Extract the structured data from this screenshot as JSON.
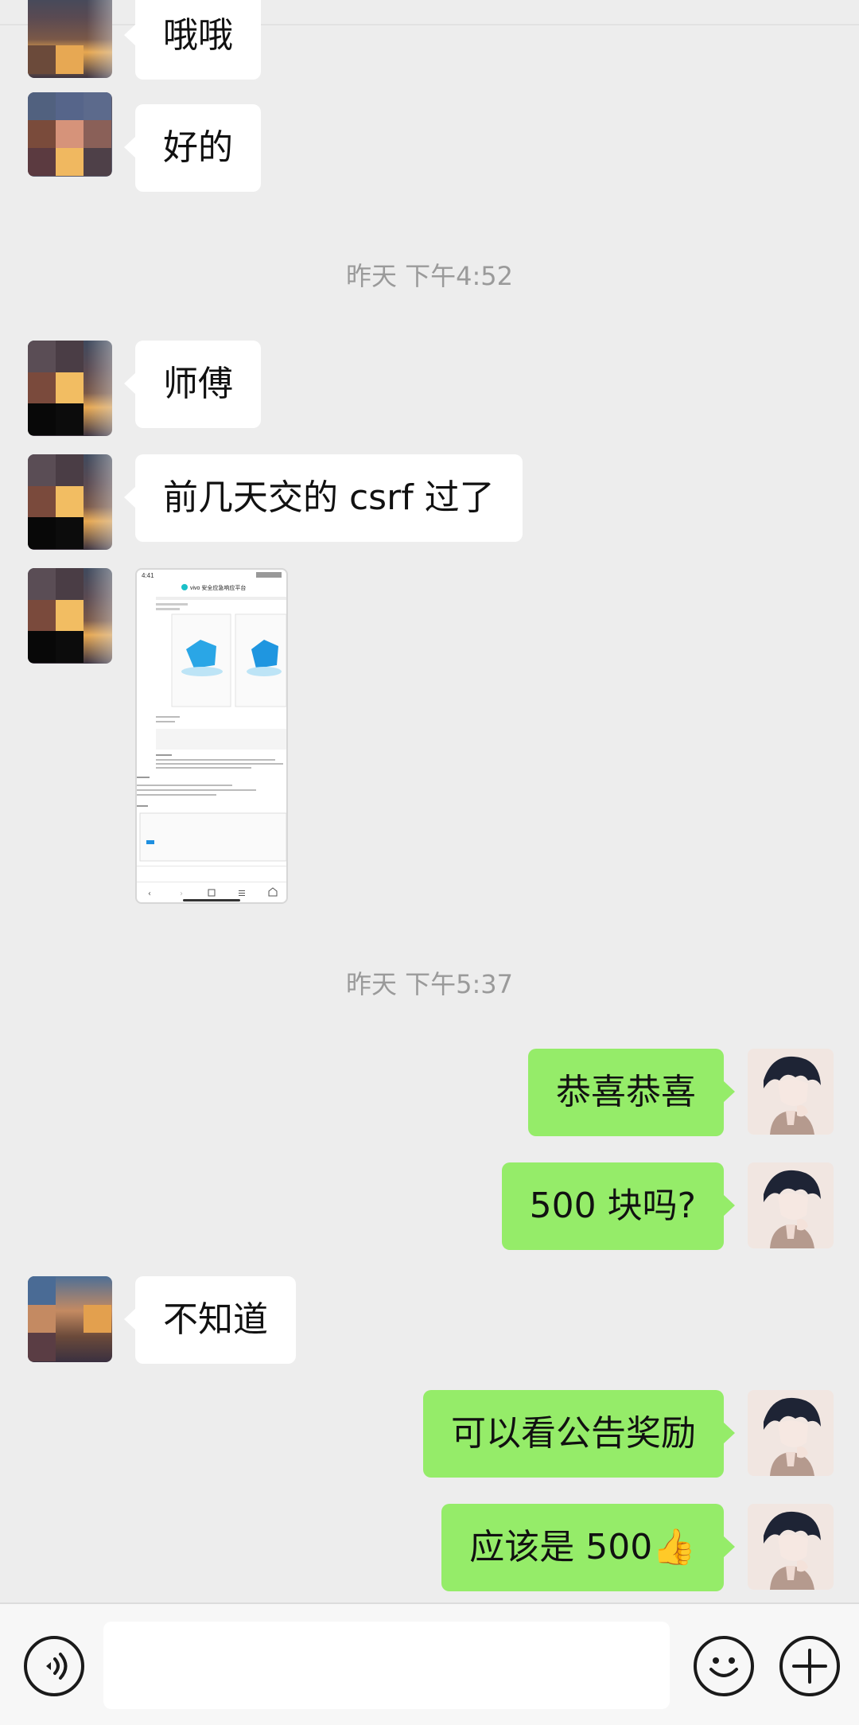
{
  "chat": {
    "messages": [
      {
        "text": "哦哦"
      },
      {
        "text": "好的"
      },
      {
        "text": "师傅"
      },
      {
        "text": "前几天交的 csrf 过了"
      },
      {
        "text": "恭喜恭喜"
      },
      {
        "text": "500 块吗?"
      },
      {
        "text": "不知道"
      },
      {
        "text": "可以看公告奖励"
      },
      {
        "text": "应该是 500"
      }
    ],
    "timestamps": [
      "昨天 下午4:52",
      "昨天 下午5:37"
    ],
    "emoji": "👍"
  },
  "screenshot_thumb": {
    "status_time": "4:41",
    "title": "vivo 安全应急响应平台"
  },
  "input_bar": {
    "voice_icon": "voice-icon",
    "emoji_icon": "emoji-icon",
    "plus_icon": "plus-icon",
    "placeholder": ""
  },
  "colors": {
    "outgoing_bubble": "#95ec69",
    "incoming_bubble": "#ffffff",
    "background": "#ededed"
  }
}
